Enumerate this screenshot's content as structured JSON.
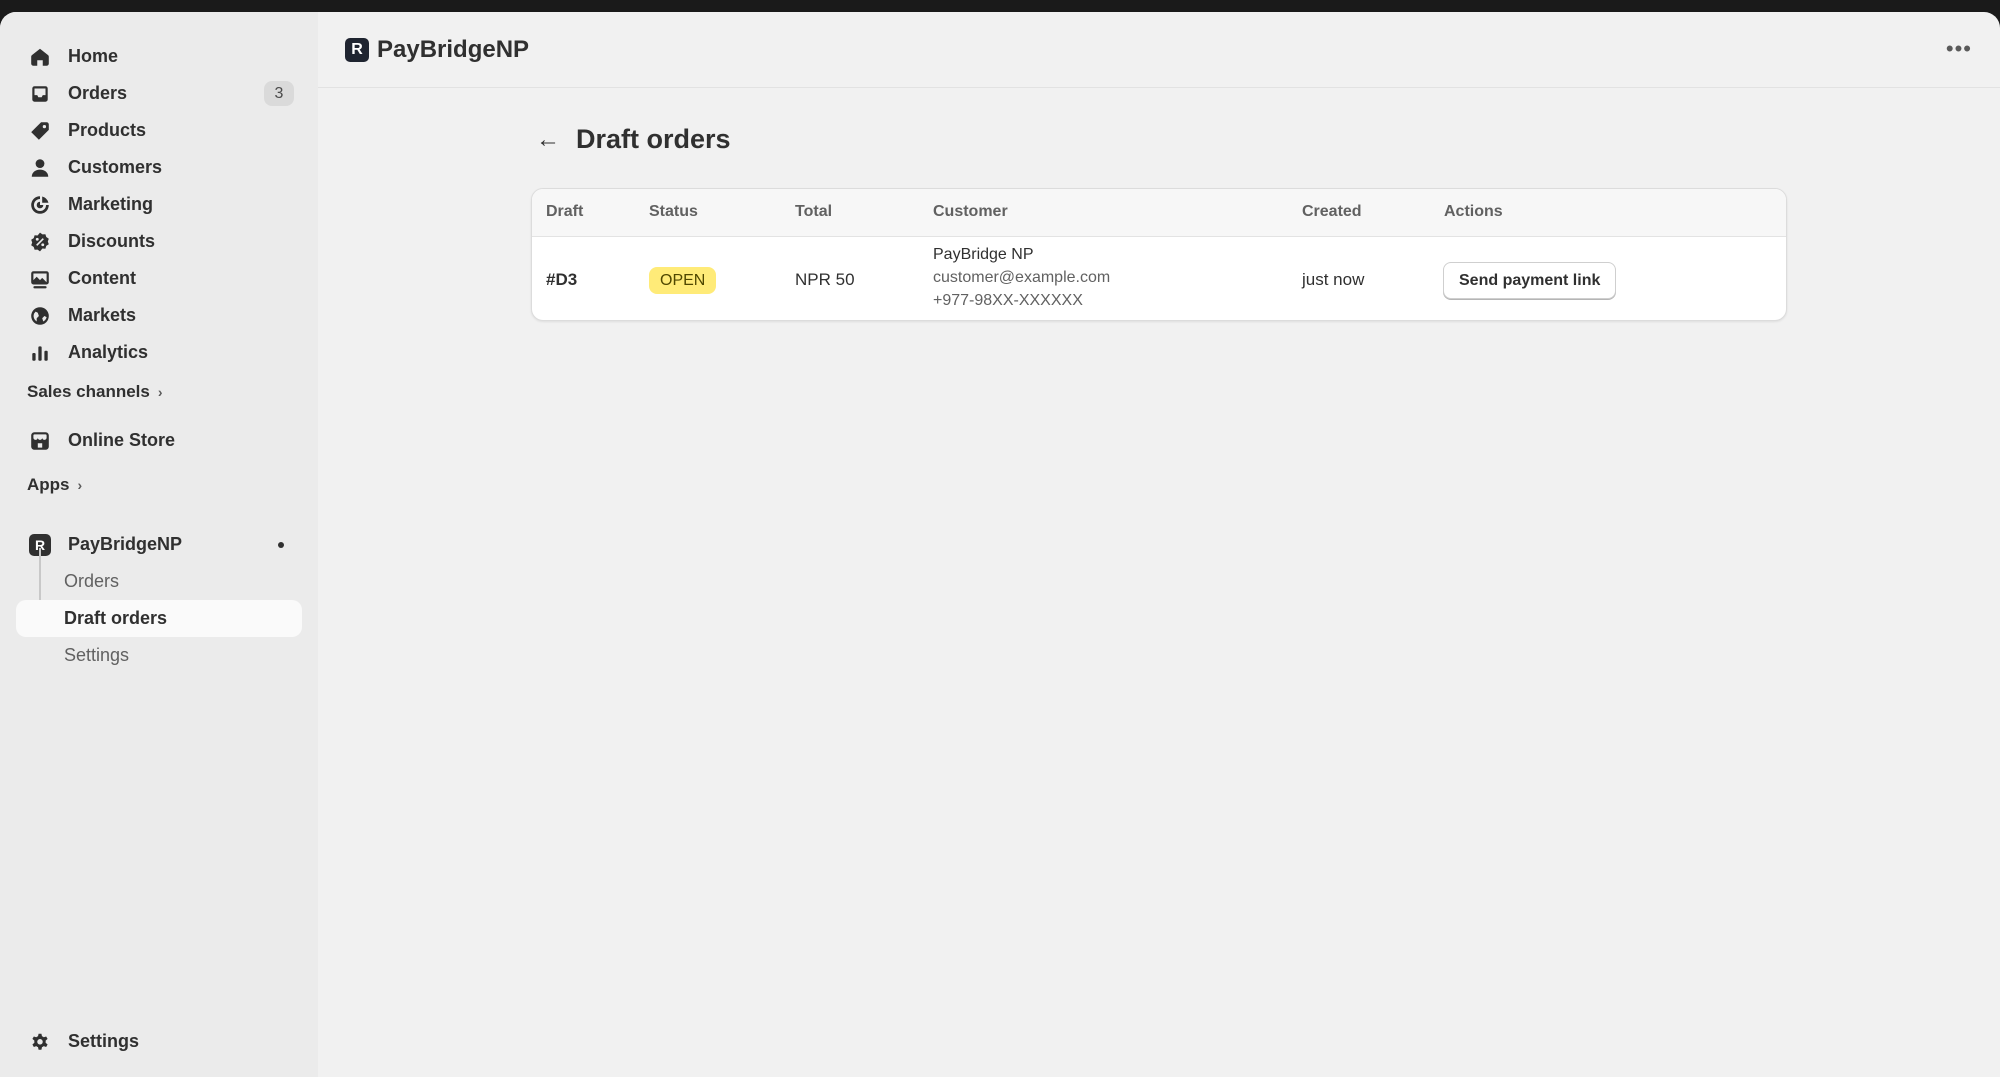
{
  "app": {
    "title": "PayBridgeNP",
    "logo_letter": "R"
  },
  "sidebar": {
    "items": [
      {
        "label": "Home",
        "icon": "home-icon"
      },
      {
        "label": "Orders",
        "icon": "inbox-icon",
        "count": "3"
      },
      {
        "label": "Products",
        "icon": "tag-icon"
      },
      {
        "label": "Customers",
        "icon": "person-icon"
      },
      {
        "label": "Marketing",
        "icon": "target-icon"
      },
      {
        "label": "Discounts",
        "icon": "discount-icon"
      },
      {
        "label": "Content",
        "icon": "image-icon"
      },
      {
        "label": "Markets",
        "icon": "globe-icon"
      },
      {
        "label": "Analytics",
        "icon": "bar-chart-icon"
      }
    ],
    "sales_channels": {
      "label": "Sales channels",
      "items": [
        {
          "label": "Online Store",
          "icon": "store-icon"
        }
      ]
    },
    "apps": {
      "label": "Apps"
    },
    "app_section": {
      "label": "PayBridgeNP",
      "logo_letter": "R",
      "sub_items": [
        {
          "label": "Orders"
        },
        {
          "label": "Draft orders",
          "active": true
        },
        {
          "label": "Settings"
        }
      ]
    },
    "settings": {
      "label": "Settings",
      "icon": "gear-icon"
    }
  },
  "page": {
    "title": "Draft orders",
    "back_icon": "arrow-left-icon"
  },
  "table": {
    "headers": {
      "draft": "Draft",
      "status": "Status",
      "total": "Total",
      "customer": "Customer",
      "created": "Created",
      "actions": "Actions"
    },
    "rows": [
      {
        "draft": "#D3",
        "status": "OPEN",
        "total": "NPR 50",
        "customer_name": "PayBridge NP",
        "customer_email": "customer@example.com",
        "customer_phone": "+977-98XX-XXXXXX",
        "created": "just now",
        "action": "Send payment link"
      }
    ]
  },
  "colors": {
    "status_open_bg": "#ffeb78",
    "sidebar_bg": "#ebebeb",
    "page_bg": "#f1f1f1"
  }
}
